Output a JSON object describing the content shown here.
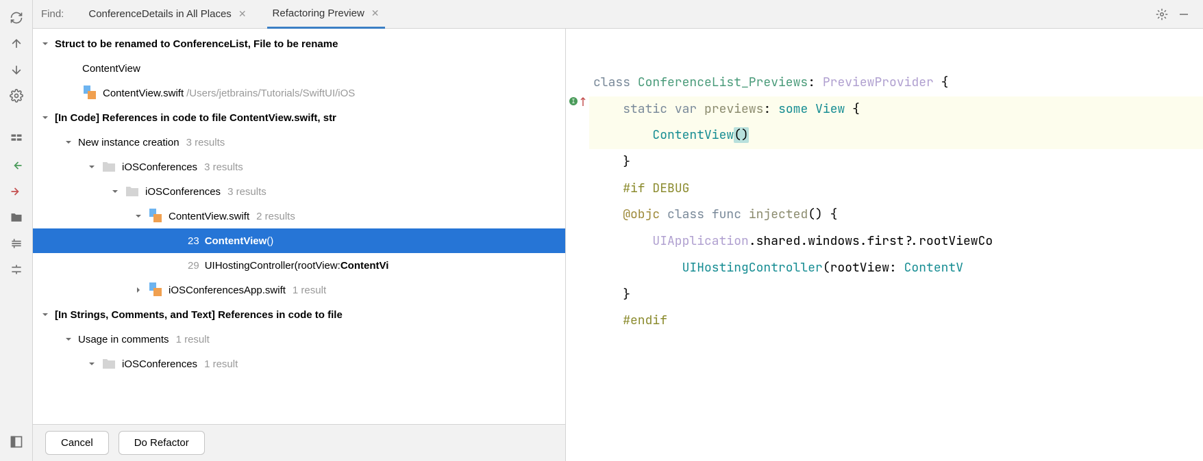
{
  "topbar": {
    "find_label": "Find:",
    "tabs": [
      {
        "label": "ConferenceDetails in All Places",
        "active": false
      },
      {
        "label": "Refactoring Preview",
        "active": true
      }
    ]
  },
  "tree": {
    "root_label": "Struct to be renamed to ConferenceList, File to be rename",
    "contentview_label": "ContentView",
    "contentview_file": "ContentView.swift",
    "contentview_path": "/Users/jetbrains/Tutorials/SwiftUI/iOS",
    "in_code_label": "[In Code] References in code to file ContentView.swift, str",
    "new_instance_label": "New instance creation",
    "new_instance_count": "3 results",
    "folder1_label": "iOSConferences",
    "folder1_count": "3 results",
    "folder2_label": "iOSConferences",
    "folder2_count": "3 results",
    "file_cv_label": "ContentView.swift",
    "file_cv_count": "2 results",
    "usage1_line": "23",
    "usage1_pre": "",
    "usage1_bold": "ContentView",
    "usage1_post": "()",
    "usage2_line": "29",
    "usage2_pre": "UIHostingController(rootView: ",
    "usage2_bold": "ContentVi",
    "file_app_label": "iOSConferencesApp.swift",
    "file_app_count": "1 result",
    "in_strings_label": "[In Strings, Comments, and Text] References in code to file",
    "usage_comments_label": "Usage in comments",
    "usage_comments_count": "1 result",
    "folder3_label": "iOSConferences",
    "folder3_count": "1 result"
  },
  "footer": {
    "cancel": "Cancel",
    "do_refactor": "Do Refactor"
  },
  "code": {
    "l1_class": "class",
    "l1_name": "ConferenceList_Previews",
    "l1_colon": ":",
    "l1_proto": "PreviewProvider",
    "l1_brace": " {",
    "l2_static": "static",
    "l2_var": "var",
    "l2_previews": "previews",
    "l2_colon": ":",
    "l2_some": "some",
    "l2_view": "View",
    "l2_brace": " {",
    "l3_contentview": "ContentView",
    "l3_call": "()",
    "l4": "    }",
    "l5": "",
    "l6_if": "#if",
    "l6_debug": "DEBUG",
    "l7_objc": "@objc",
    "l7_class": "class",
    "l7_func": "func",
    "l7_injected": "injected",
    "l7_rest": "() {",
    "l8_a": "UIApplication",
    "l8_b": ".shared.windows.first?.rootViewCo",
    "l9_a": "UIHostingController",
    "l9_b": "(rootView: ",
    "l9_c": "ContentV",
    "l10": "    }",
    "l11": "#endif"
  }
}
